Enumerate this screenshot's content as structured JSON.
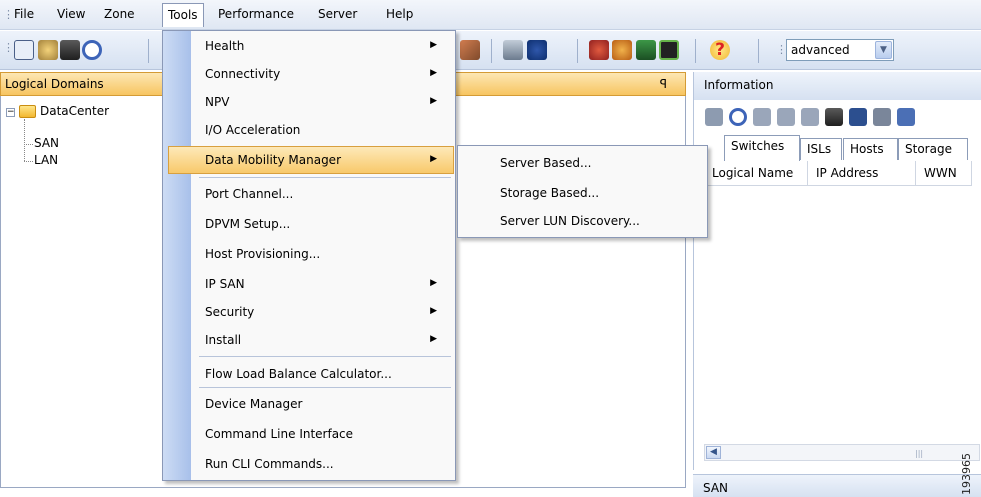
{
  "menubar": {
    "items": [
      "File",
      "View",
      "Zone",
      "Tools",
      "Performance",
      "Server",
      "Help"
    ]
  },
  "toolbar": {
    "mode_select": "advanced",
    "icons": [
      "new-icon",
      "connect-icon",
      "find-icon",
      "refresh-icon",
      "chart-icon",
      "fabric-icon",
      "user-icon",
      "discover-icon",
      "report-icon",
      "monitor-icon",
      "help-icon"
    ]
  },
  "left_panel": {
    "title": "Logical Domains",
    "pin": "ꟼ",
    "tree": {
      "root": "DataCenter",
      "children": [
        "SAN",
        "LAN"
      ]
    }
  },
  "tools_menu": {
    "items": [
      {
        "label": "Health",
        "submenu": true
      },
      {
        "label": "Connectivity",
        "submenu": true
      },
      {
        "label": "NPV",
        "submenu": true
      },
      {
        "label": "I/O Acceleration",
        "submenu": false
      },
      {
        "label": "Data Mobility Manager",
        "submenu": true,
        "highlighted": true
      },
      {
        "label": "Port Channel...",
        "submenu": false
      },
      {
        "label": "DPVM Setup...",
        "submenu": false
      },
      {
        "label": "Host Provisioning...",
        "submenu": false
      },
      {
        "label": "IP SAN",
        "submenu": true
      },
      {
        "label": "Security",
        "submenu": true
      },
      {
        "label": "Install",
        "submenu": true
      },
      {
        "label": "Flow Load Balance Calculator...",
        "submenu": false
      },
      {
        "label": "Device Manager",
        "submenu": false
      },
      {
        "label": "Command Line Interface",
        "submenu": false
      },
      {
        "label": "Run CLI Commands...",
        "submenu": false
      }
    ]
  },
  "dmm_submenu": {
    "items": [
      "Server Based...",
      "Storage Based...",
      "Server LUN Discovery..."
    ]
  },
  "info_panel": {
    "title": "Information",
    "tabs": [
      "Switches",
      "ISLs",
      "Hosts",
      "Storage"
    ],
    "columns": [
      "Logical Name",
      "IP Address",
      "WWN"
    ],
    "bottom_title": "SAN"
  },
  "watermark": "193965",
  "colors": {
    "highlight": "#f8c96b",
    "panel_title": "#f7c561",
    "menu_gutter": "#a8c0ea"
  }
}
